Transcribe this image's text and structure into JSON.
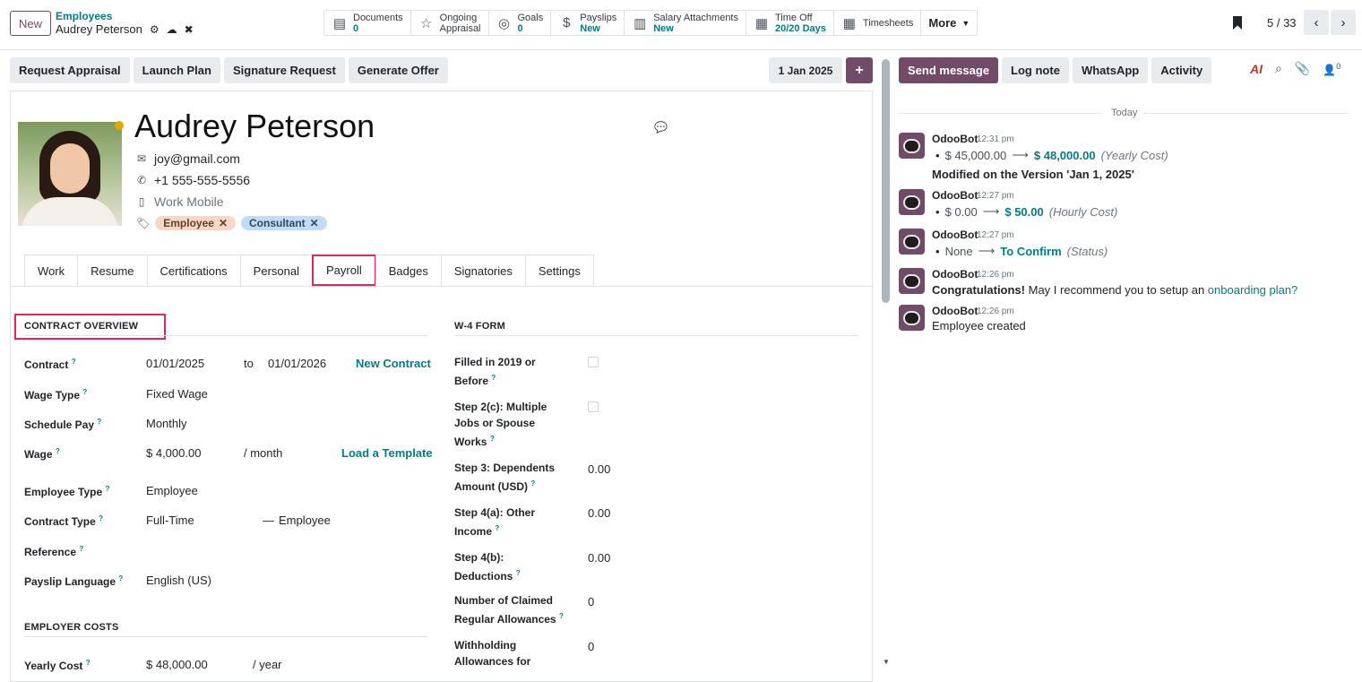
{
  "header": {
    "new_label": "New",
    "breadcrumb_parent": "Employees",
    "breadcrumb_current": "Audrey Peterson",
    "pager": "5 / 33"
  },
  "smart_buttons": [
    {
      "label": "Documents",
      "value": "0",
      "icon": "file-icon"
    },
    {
      "label": "Ongoing",
      "label2": "Appraisal",
      "icon": "star-icon"
    },
    {
      "label": "Goals",
      "value": "0",
      "icon": "bullseye-icon"
    },
    {
      "label": "Payslips",
      "value": "New",
      "icon": "dollar-icon"
    },
    {
      "label": "Salary Attachments",
      "value": "New",
      "icon": "book-icon"
    },
    {
      "label": "Time Off",
      "value": "20/20 Days",
      "icon": "calendar-icon"
    },
    {
      "label": "Timesheets",
      "icon": "calendar-icon"
    },
    {
      "label": "More"
    }
  ],
  "actions": [
    "Request Appraisal",
    "Launch Plan",
    "Signature Request",
    "Generate Offer"
  ],
  "version_date": "1 Jan 2025",
  "employee": {
    "name": "Audrey Peterson",
    "email": "joy@gmail.com",
    "phone": "+1 555-555-5556",
    "mobile_placeholder": "Work Mobile",
    "tags": [
      "Employee",
      "Consultant"
    ]
  },
  "tabs": [
    "Work",
    "Resume",
    "Certifications",
    "Personal",
    "Payroll",
    "Badges",
    "Signatories",
    "Settings"
  ],
  "contract_overview": {
    "title": "CONTRACT OVERVIEW",
    "contract_label": "Contract",
    "contract_start": "01/01/2025",
    "to": "to",
    "contract_end": "01/01/2026",
    "new_contract": "New Contract",
    "wage_type_label": "Wage Type",
    "wage_type": "Fixed Wage",
    "schedule_pay_label": "Schedule Pay",
    "schedule_pay": "Monthly",
    "wage_label": "Wage",
    "wage": "$ 4,000.00",
    "wage_unit": "/ month",
    "load_template": "Load a Template",
    "employee_type_label": "Employee Type",
    "employee_type": "Employee",
    "contract_type_label": "Contract Type",
    "contract_type": "Full-Time",
    "contract_type_dash": "—",
    "contract_type_sub": "Employee",
    "reference_label": "Reference",
    "payslip_language_label": "Payslip Language",
    "payslip_language": "English (US)"
  },
  "employer_costs": {
    "title": "EMPLOYER COSTS",
    "yearly_cost_label": "Yearly Cost",
    "yearly_cost": "$ 48,000.00",
    "yearly_unit": "/ year"
  },
  "w4": {
    "title": "W-4 FORM",
    "filled_label_1": "Filled in 2019 or",
    "filled_label_2": "Before",
    "step2c_1": "Step 2(c): Multiple",
    "step2c_2": "Jobs or Spouse",
    "step2c_3": "Works",
    "step3_1": "Step 3: Dependents",
    "step3_2": "Amount (USD)",
    "step3_val": "0.00",
    "step4a_1": "Step 4(a): Other",
    "step4a_2": "Income",
    "step4a_val": "0.00",
    "step4b_1": "Step 4(b):",
    "step4b_2": "Deductions",
    "step4b_val": "0.00",
    "allow_1": "Number of Claimed",
    "allow_2": "Regular Allowances",
    "allow_val": "0",
    "withhold_1": "Withholding",
    "withhold_2": "Allowances for",
    "withhold_val": "0"
  },
  "chatter": {
    "send_message": "Send message",
    "log_note": "Log note",
    "whatsapp": "WhatsApp",
    "activity": "Activity",
    "ai_label": "AI",
    "follower_count": "0",
    "today": "Today",
    "messages": [
      {
        "author": "OdooBot",
        "time": "12:31 pm",
        "old": "$ 45,000.00",
        "new": "$ 48,000.00",
        "field": "(Yearly Cost)",
        "note": "Modified on the Version 'Jan 1, 2025'"
      },
      {
        "author": "OdooBot",
        "time": "12:27 pm",
        "old": "$ 0.00",
        "new": "$ 50.00",
        "field": "(Hourly Cost)"
      },
      {
        "author": "OdooBot",
        "time": "12:27 pm",
        "old": "None",
        "new": "To Confirm",
        "field": "(Status)"
      },
      {
        "author": "OdooBot",
        "time": "12:26 pm",
        "bold": "Congratulations!",
        "text": "May I recommend you to setup an",
        "link": "onboarding plan?"
      },
      {
        "author": "OdooBot",
        "time": "12:26 pm",
        "text": "Employee created"
      }
    ]
  }
}
